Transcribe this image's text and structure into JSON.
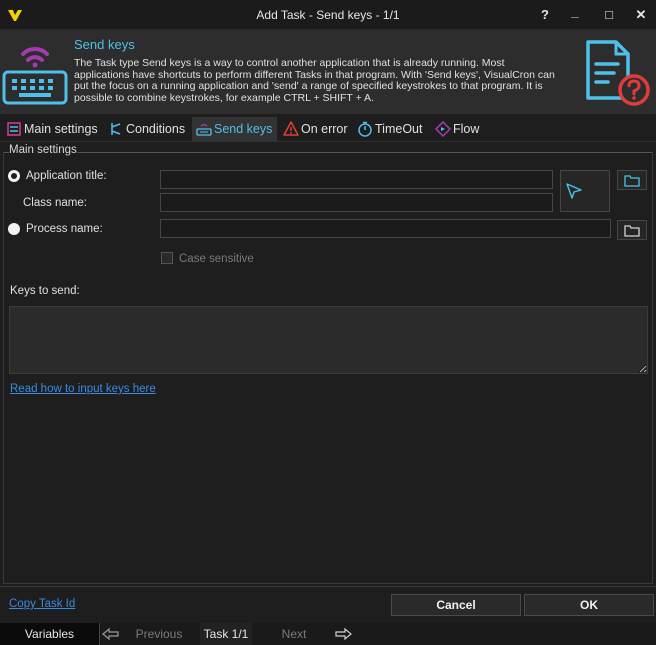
{
  "window": {
    "title": "Add Task - Send keys - 1/1",
    "help": "?",
    "minimize": "_",
    "maximize": "□",
    "close": "✕"
  },
  "header": {
    "title": "Send keys",
    "description": "The Task type Send keys is a way to control another application that is already running. Most applications have shortcuts to perform different Tasks in that program. With 'Send keys', VisualCron can put the focus on a running application and 'send' a range of specified keystrokes to that program. It is possible to combine keystrokes, for example CTRL + SHIFT + A."
  },
  "tabs": [
    {
      "label": "Main settings",
      "icon": "settings-icon"
    },
    {
      "label": "Conditions",
      "icon": "conditions-icon"
    },
    {
      "label": "Send keys",
      "icon": "keyboard-icon"
    },
    {
      "label": "On error",
      "icon": "warning-icon"
    },
    {
      "label": "TimeOut",
      "icon": "stopwatch-icon"
    },
    {
      "label": "Flow",
      "icon": "flow-icon"
    }
  ],
  "main": {
    "group_label": "Main settings",
    "application_title_label": "Application title:",
    "application_title_value": "",
    "class_name_label": "Class name:",
    "class_name_value": "",
    "process_name_label": "Process name:",
    "process_name_value": "",
    "case_sensitive_label": "Case sensitive",
    "keys_label": "Keys to send:",
    "keys_value": "",
    "help_link": "Read how to input keys here",
    "selected_radio": "application_title"
  },
  "footer": {
    "copy_task_id": "Copy Task Id",
    "cancel": "Cancel",
    "ok": "OK"
  },
  "navbar": {
    "variables": "Variables",
    "previous": "Previous",
    "task": "Task 1/1",
    "next": "Next"
  },
  "colors": {
    "accent": "#4fc1e9",
    "brand_icon": "#a63ab0",
    "warning": "#e03c3c",
    "link": "#3a8be0"
  }
}
